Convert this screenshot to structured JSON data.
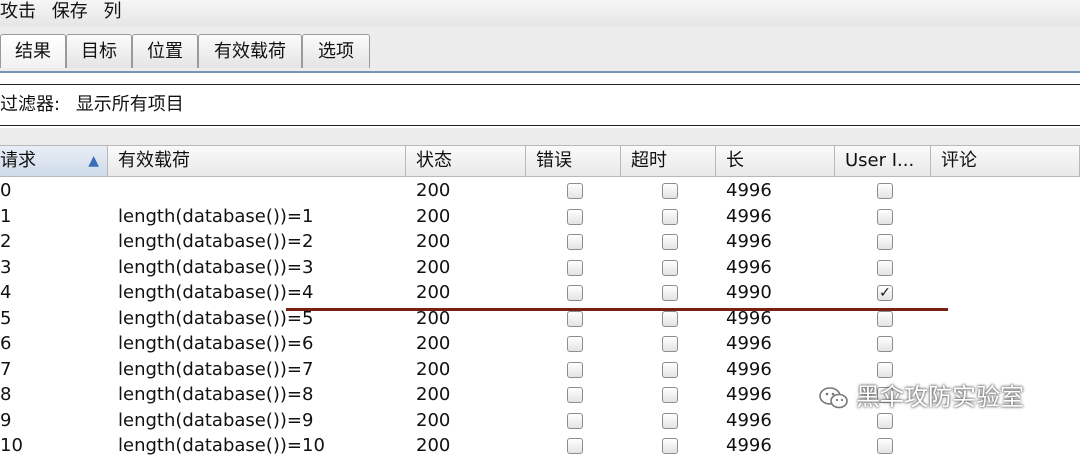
{
  "menu": [
    "攻击",
    "保存",
    "列"
  ],
  "tabs": [
    "结果",
    "目标",
    "位置",
    "有效载荷",
    "选项"
  ],
  "filter": {
    "label": "过滤器:",
    "value": "显示所有项目"
  },
  "columns": [
    "请求",
    "有效载荷",
    "状态",
    "错误",
    "超时",
    "长",
    "User I...",
    "评论"
  ],
  "rows": [
    {
      "req": "0",
      "payload": "",
      "status": "200",
      "length": "4996",
      "user": false
    },
    {
      "req": "1",
      "payload": "length(database())=1",
      "status": "200",
      "length": "4996",
      "user": false
    },
    {
      "req": "2",
      "payload": "length(database())=2",
      "status": "200",
      "length": "4996",
      "user": false
    },
    {
      "req": "3",
      "payload": "length(database())=3",
      "status": "200",
      "length": "4996",
      "user": false
    },
    {
      "req": "4",
      "payload": "length(database())=4",
      "status": "200",
      "length": "4990",
      "user": true
    },
    {
      "req": "5",
      "payload": "length(database())=5",
      "status": "200",
      "length": "4996",
      "user": false
    },
    {
      "req": "6",
      "payload": "length(database())=6",
      "status": "200",
      "length": "4996",
      "user": false
    },
    {
      "req": "7",
      "payload": "length(database())=7",
      "status": "200",
      "length": "4996",
      "user": false
    },
    {
      "req": "8",
      "payload": "length(database())=8",
      "status": "200",
      "length": "4996",
      "user": false
    },
    {
      "req": "9",
      "payload": "length(database())=9",
      "status": "200",
      "length": "4996",
      "user": false
    },
    {
      "req": "10",
      "payload": "length(database())=10",
      "status": "200",
      "length": "4996",
      "user": false
    }
  ],
  "watermark": "黑伞攻防实验室",
  "icons": {
    "sort": "sort-ascending-icon",
    "watermark": "wechat-icon"
  }
}
